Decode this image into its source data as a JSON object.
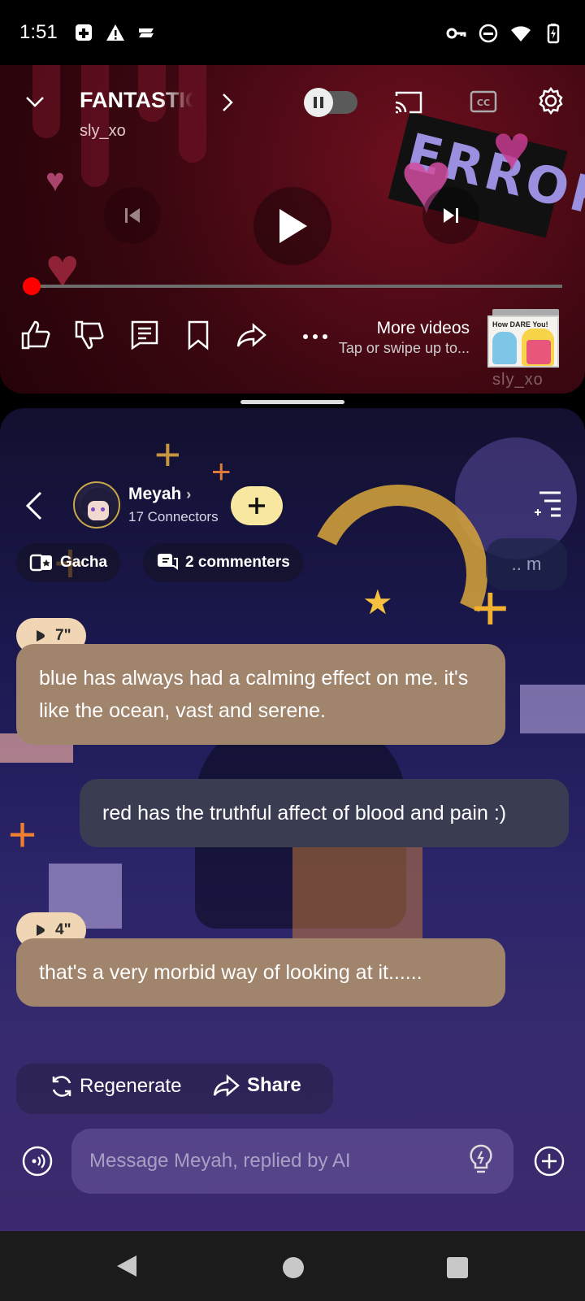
{
  "status_bar": {
    "time": "1:51"
  },
  "player": {
    "title": "FANTASTIC",
    "channel": "sly_xo",
    "more_videos_title": "More videos",
    "more_videos_subtitle": "Tap or swipe up to...",
    "thumbnail_text": "How DARE You!",
    "thumbnail_caption": "sly_xo",
    "sticker_text": "ERROR",
    "progress": 0.0,
    "accent_color": "#ff0000"
  },
  "chat": {
    "character_name": "Meyah",
    "connectors": "17 Connectors",
    "chips": {
      "gacha": "Gacha",
      "commenters": "2 commenters"
    },
    "memory_pill": ".. m",
    "messages": [
      {
        "role": "ai",
        "duration": "7\"",
        "text": "blue has always had a calming effect on me. it's like the ocean, vast and serene."
      },
      {
        "role": "user",
        "text": "red has the truthful affect of blood and pain :)"
      },
      {
        "role": "ai",
        "duration": "4\"",
        "text": "that's a very morbid way of looking at it......"
      }
    ],
    "regenerate_label": "Regenerate",
    "share_label": "Share",
    "input_placeholder": "Message Meyah, replied by AI",
    "colors": {
      "ai_bubble": "#a0846c",
      "user_bubble": "#3a3c52",
      "follow_button": "#f7e7a0"
    }
  }
}
